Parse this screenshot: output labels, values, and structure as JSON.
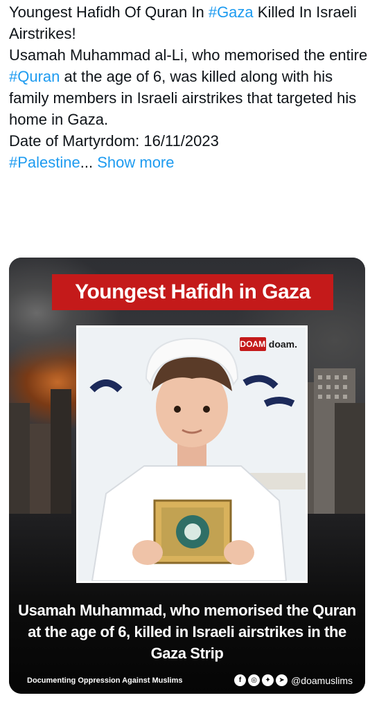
{
  "tweet": {
    "line1_start": "Youngest Hafidh Of Quran In ",
    "hashtag_gaza": "#Gaza",
    "line1_end": " Killed In Israeli Airstrikes!",
    "para2_start": "Usamah Muhammad al-Li, who memorised the entire ",
    "hashtag_quran": "#Quran",
    "para2_end": " at the age of 6, was killed along with his family members in Israeli airstrikes that targeted his home in Gaza.",
    "date_line": "Date of Martyrdom: 16/11/2023",
    "hashtag_palestine": "#Palestine",
    "ellipsis": "...",
    "show_more": "Show more"
  },
  "media": {
    "banner_title": "Youngest Hafidh in Gaza",
    "logo_mark": "DOAM",
    "logo_text": "doam.",
    "caption": "Usamah Muhammad, who memorised the Quran at the age of 6,  killed in Israeli airstrikes in the Gaza Strip",
    "footer_left": "Documenting Oppression Against Muslims",
    "handle": "@doamuslims",
    "social_icons": [
      "facebook-icon",
      "instagram-icon",
      "twitter-icon",
      "telegram-icon"
    ]
  },
  "colors": {
    "link": "#1d9bf0",
    "text": "#0f1419",
    "banner_red": "#c41a1a"
  }
}
